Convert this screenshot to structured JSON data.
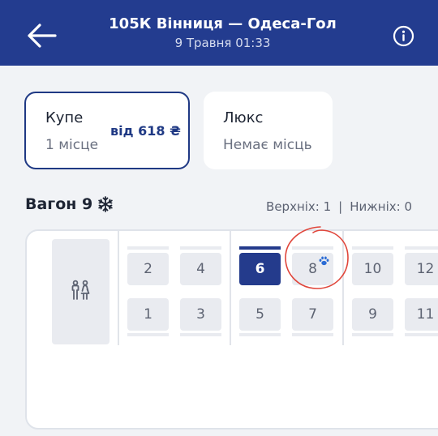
{
  "header": {
    "title": "105К Вінниця — Одеса-Гол",
    "subtitle": "9 Травня 01:33"
  },
  "classes": [
    {
      "name": "Купе",
      "sub": "1 місце",
      "price": "від 618 ₴"
    },
    {
      "name": "Люкс",
      "sub": "Немає місць"
    }
  ],
  "wagon": {
    "title": "Вагон 9",
    "upper": "Верхніх: 1",
    "lower": "Нижніх: 0",
    "separator": "|"
  },
  "seats": {
    "s2": "2",
    "s4": "4",
    "s6": "6",
    "s8": "8",
    "s10": "10",
    "s12": "12",
    "s1": "1",
    "s3": "3",
    "s5": "5",
    "s7": "7",
    "s9": "9",
    "s11": "11"
  },
  "colors": {
    "primary": "#233c8f",
    "selected_seat": "#243b8c",
    "free_seat": "#e9ebf0",
    "annotation": "#e0463b"
  },
  "icons": [
    "back-arrow-icon",
    "info-icon",
    "snowflake-icon",
    "restroom-icon",
    "paw-icon"
  ]
}
